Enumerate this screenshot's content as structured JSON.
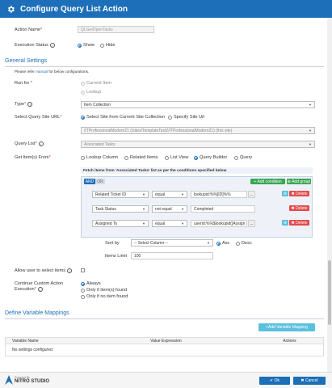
{
  "dialog": {
    "title": "Configure Query List Action",
    "action_name_label": "Action Name",
    "action_name_value": "QLGetOpenTasks",
    "execution_status_label": "Execution Status",
    "execution_status_options": [
      "Show",
      "Hide"
    ],
    "execution_status_selected": "Show"
  },
  "general": {
    "title": "General Settings",
    "note_prefix": "Please refer",
    "note_link": "manual",
    "note_suffix": "for below configurations.",
    "run_for_label": "Run for",
    "run_for_options": [
      "Current Item",
      "Lookup"
    ],
    "type_label": "Type",
    "type_value": "Item Collection",
    "site_url_label": "Select Query Site URL",
    "site_url_options": [
      "Select Site from Current Site Collection",
      "Specify Site Url"
    ],
    "site_url_value": "/ITProfessionalModern21 (/sites/TemplateTest2/ITProfessionalModern21) (this site)",
    "query_list_label": "Query List",
    "query_list_value": "Associated Tasks",
    "get_items_label": "Get Item(s) From",
    "get_items_options": [
      "Lookup Column",
      "Related Items",
      "List View",
      "Query Builder",
      "Query"
    ],
    "get_items_selected": "Query Builder",
    "fetch_text": "Fetch items from 'Associated Tasks' list as per the conditions specified below",
    "and_label": "AND",
    "or_label": "OR",
    "add_condition_label": "+ Add condition",
    "add_group_label": "⊕ Add group",
    "conditions": [
      {
        "field": "Related Ticket ID",
        "operator": "equal",
        "value": "lookupid:%%[ID]%%"
      },
      {
        "field": "Task Status",
        "operator": "not equal",
        "value": "Completed"
      },
      {
        "field": "Assigned To",
        "operator": "equal",
        "value": "userid:%%$lookupid([Assign"
      }
    ],
    "delete_label": "Delete",
    "ellipsis": "...",
    "sort_by_label": "Sort by",
    "sort_by_value": "-- Select Column --",
    "sort_asc": "Asc",
    "sort_desc": "Desc",
    "items_limit_label": "Items Limit",
    "items_limit_value": "100",
    "allow_user_label": "Allow user to select items",
    "continue_label_1": "Continue Custom Action",
    "continue_label_2": "Execution",
    "continue_options": [
      "Always",
      "Only if item(s) found",
      "Only if no item found"
    ]
  },
  "mappings": {
    "title": "Define Variable Mappings",
    "add_button": "+Add Variable Mapping",
    "columns": [
      "Variable Name",
      "Value Expression",
      "Actions"
    ],
    "empty_text": "No settings configured"
  },
  "footer": {
    "powered_by": "Powered By",
    "brand": "NITRO STUDIO",
    "ok_label": "Ok",
    "cancel_label": "Cancel"
  },
  "colors": {
    "primary": "#1c6fb8",
    "danger": "#e14b4b",
    "success": "#3aa655",
    "info": "#5bc0de"
  }
}
